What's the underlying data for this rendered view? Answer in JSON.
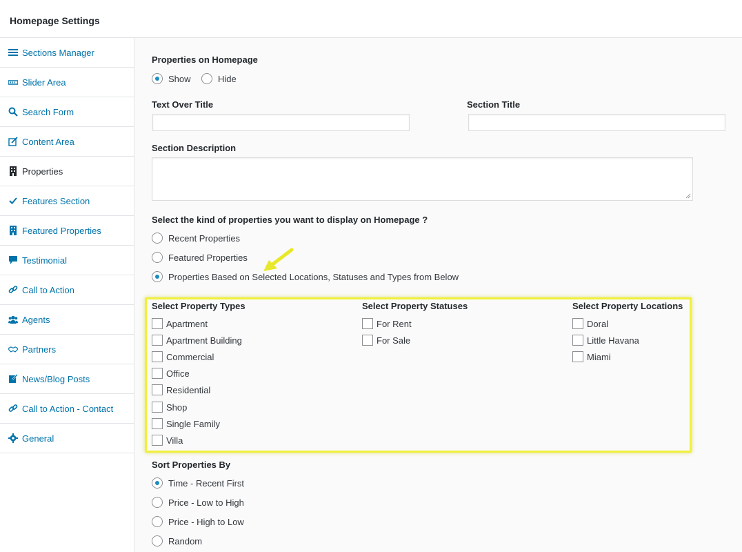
{
  "header": {
    "title": "Homepage Settings"
  },
  "sidebar": {
    "items": [
      {
        "label": "Sections Manager",
        "icon": "menu-icon"
      },
      {
        "label": "Slider Area",
        "icon": "slider-icon"
      },
      {
        "label": "Search Form",
        "icon": "search-icon"
      },
      {
        "label": "Content Area",
        "icon": "edit-icon"
      },
      {
        "label": "Properties",
        "icon": "building-icon"
      },
      {
        "label": "Features Section",
        "icon": "check-icon"
      },
      {
        "label": "Featured Properties",
        "icon": "building-icon"
      },
      {
        "label": "Testimonial",
        "icon": "comment-icon"
      },
      {
        "label": "Call to Action",
        "icon": "link-icon"
      },
      {
        "label": "Agents",
        "icon": "users-icon"
      },
      {
        "label": "Partners",
        "icon": "handshake-icon"
      },
      {
        "label": "News/Blog Posts",
        "icon": "post-edit-icon"
      },
      {
        "label": "Call to Action - Contact",
        "icon": "link-icon"
      },
      {
        "label": "General",
        "icon": "gear-icon"
      }
    ],
    "active": "Properties"
  },
  "main": {
    "properties_on_homepage": {
      "label": "Properties on Homepage",
      "options": [
        "Show",
        "Hide"
      ],
      "selected": "Show"
    },
    "text_over_title": {
      "label": "Text Over Title",
      "value": ""
    },
    "section_title": {
      "label": "Section Title",
      "value": ""
    },
    "section_description": {
      "label": "Section Description",
      "value": ""
    },
    "kind": {
      "label": "Select the kind of properties you want to display on Homepage ?",
      "options": [
        "Recent Properties",
        "Featured Properties",
        "Properties Based on Selected Locations, Statuses and Types from Below"
      ],
      "selected": "Properties Based on Selected Locations, Statuses and Types from Below"
    },
    "types": {
      "label": "Select Property Types",
      "items": [
        "Apartment",
        "Apartment Building",
        "Commercial",
        "Office",
        "Residential",
        "Shop",
        "Single Family",
        "Villa"
      ]
    },
    "statuses": {
      "label": "Select Property Statuses",
      "items": [
        "For Rent",
        "For Sale"
      ]
    },
    "locations": {
      "label": "Select Property Locations",
      "items": [
        "Doral",
        "Little Havana",
        "Miami"
      ]
    },
    "sort": {
      "label": "Sort Properties By",
      "options": [
        "Time - Recent First",
        "Price - Low to High",
        "Price - High to Low",
        "Random"
      ],
      "selected": "Time - Recent First"
    }
  },
  "colors": {
    "link": "#0073aa",
    "highlight": "#f0f03a",
    "arrow": "#e8e82a",
    "radio_dot": "#1e8cbe"
  }
}
